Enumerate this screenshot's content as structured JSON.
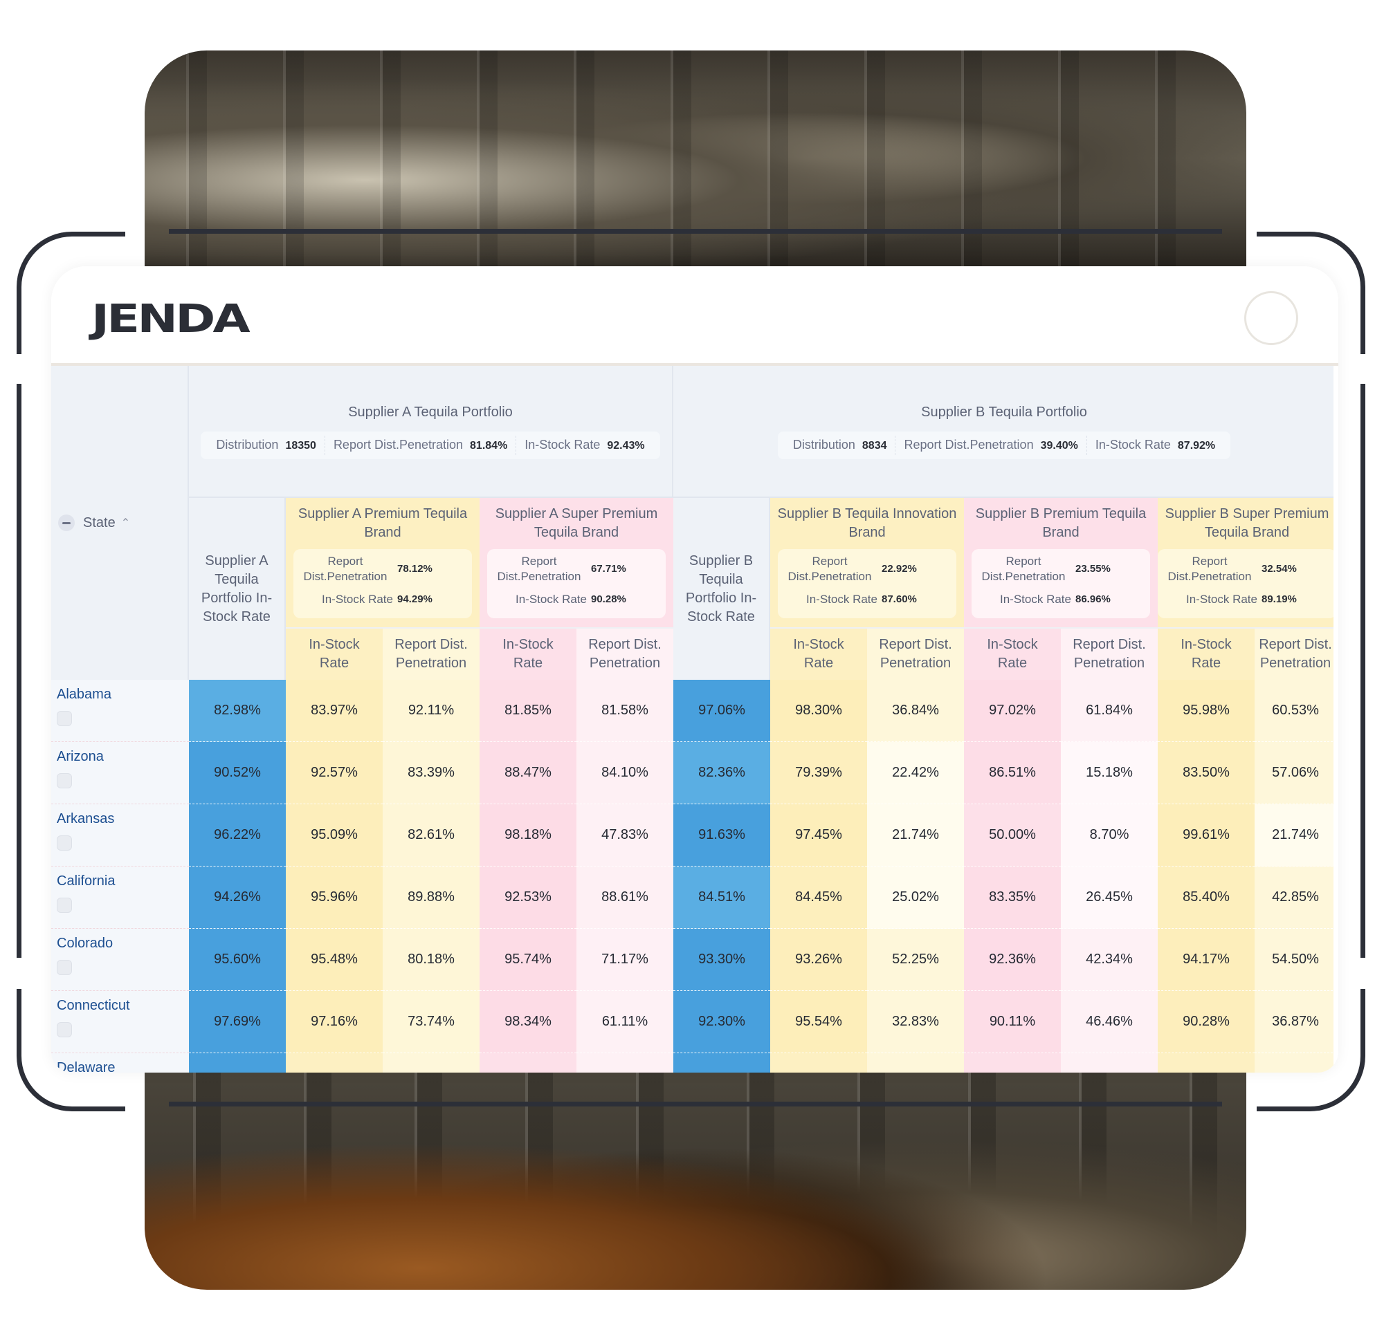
{
  "brand": {
    "logo_text": "JENDA"
  },
  "table": {
    "state_header": "State",
    "groups": [
      {
        "title": "Supplier A Tequila Portfolio",
        "stats": [
          {
            "label": "Distribution",
            "value": "18350"
          },
          {
            "label": "Report Dist.Penetration",
            "value": "81.84%"
          },
          {
            "label": "In-Stock Rate",
            "value": "92.43%"
          }
        ],
        "portfolio_column": "Supplier A Tequila Portfolio In-Stock Rate",
        "brands": [
          {
            "title": "Supplier A Premium Tequila Brand",
            "color": "yellow",
            "penetration_label": "Report Dist.Penetration",
            "penetration": "78.12%",
            "instock_label": "In-Stock Rate",
            "instock": "94.29%"
          },
          {
            "title": "Supplier A Super Premium Tequila Brand",
            "color": "pink",
            "penetration_label": "Report Dist.Penetration",
            "penetration": "67.71%",
            "instock_label": "In-Stock Rate",
            "instock": "90.28%"
          }
        ]
      },
      {
        "title": "Supplier B Tequila Portfolio",
        "stats": [
          {
            "label": "Distribution",
            "value": "8834"
          },
          {
            "label": "Report Dist.Penetration",
            "value": "39.40%"
          },
          {
            "label": "In-Stock Rate",
            "value": "87.92%"
          }
        ],
        "portfolio_column": "Supplier B Tequila Portfolio In-Stock Rate",
        "brands": [
          {
            "title": "Supplier B Tequila Innovation Brand",
            "color": "yellow",
            "penetration_label": "Report Dist.Penetration",
            "penetration": "22.92%",
            "instock_label": "In-Stock Rate",
            "instock": "87.60%"
          },
          {
            "title": "Supplier B Premium Tequila Brand",
            "color": "pink",
            "penetration_label": "Report Dist.Penetration",
            "penetration": "23.55%",
            "instock_label": "In-Stock Rate",
            "instock": "86.96%"
          },
          {
            "title": "Supplier B Super Premium Tequila Brand",
            "color": "yellow",
            "penetration_label": "Report Dist.Penetration",
            "penetration": "32.54%",
            "instock_label": "In-Stock Rate",
            "instock": "89.19%"
          }
        ]
      }
    ],
    "leaf_headers": {
      "instock": "In-Stock Rate",
      "penetration": "Report Dist. Penetration"
    },
    "colors": {
      "blue": "#48a0dd",
      "yellow": "#fdf0c2",
      "yellow_light": "#fef7da",
      "pink": "#fde0e9",
      "pink_light": "#fef1f5",
      "state_text": "#1d4f91"
    },
    "rows": [
      {
        "state": "Alabama",
        "values": [
          "82.98%",
          "83.97%",
          "92.11%",
          "81.85%",
          "81.58%",
          "97.06%",
          "98.30%",
          "36.84%",
          "97.02%",
          "61.84%",
          "95.98%",
          "60.53%"
        ]
      },
      {
        "state": "Arizona",
        "values": [
          "90.52%",
          "92.57%",
          "83.39%",
          "88.47%",
          "84.10%",
          "82.36%",
          "79.39%",
          "22.42%",
          "86.51%",
          "15.18%",
          "83.50%",
          "57.06%"
        ]
      },
      {
        "state": "Arkansas",
        "values": [
          "96.22%",
          "95.09%",
          "82.61%",
          "98.18%",
          "47.83%",
          "91.63%",
          "97.45%",
          "21.74%",
          "50.00%",
          "8.70%",
          "99.61%",
          "21.74%"
        ]
      },
      {
        "state": "California",
        "values": [
          "94.26%",
          "95.96%",
          "89.88%",
          "92.53%",
          "88.61%",
          "84.51%",
          "84.45%",
          "25.02%",
          "83.35%",
          "26.45%",
          "85.40%",
          "42.85%"
        ]
      },
      {
        "state": "Colorado",
        "values": [
          "95.60%",
          "95.48%",
          "80.18%",
          "95.74%",
          "71.17%",
          "93.30%",
          "93.26%",
          "52.25%",
          "92.36%",
          "42.34%",
          "94.17%",
          "54.50%"
        ]
      },
      {
        "state": "Connecticut",
        "values": [
          "97.69%",
          "97.16%",
          "73.74%",
          "98.34%",
          "61.11%",
          "92.30%",
          "95.54%",
          "32.83%",
          "90.11%",
          "46.46%",
          "90.28%",
          "36.87%"
        ]
      },
      {
        "state": "Delaware",
        "values": []
      }
    ]
  }
}
